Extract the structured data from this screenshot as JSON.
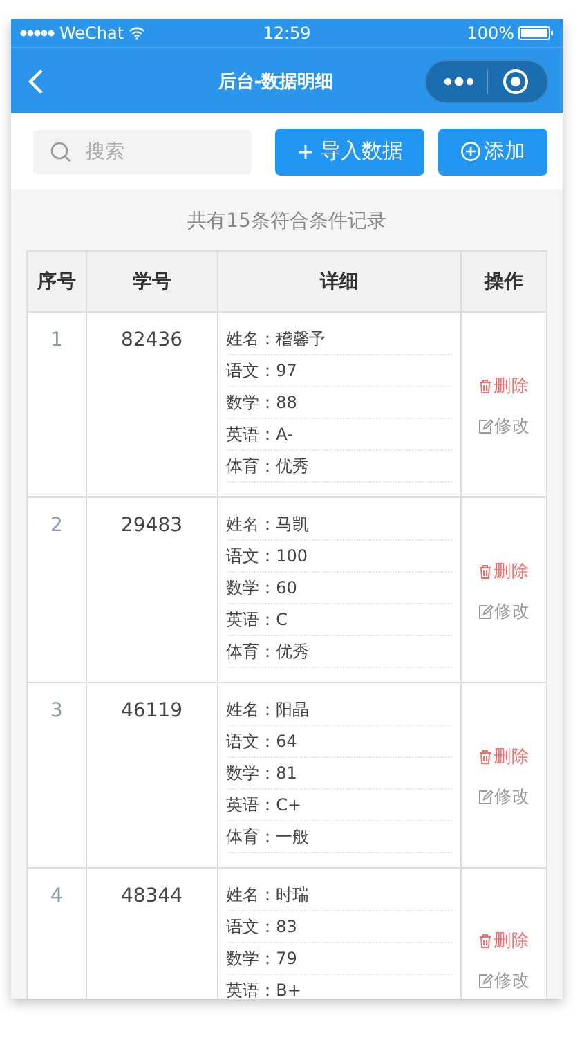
{
  "status_bar": {
    "carrier": "WeChat",
    "time": "12:59",
    "battery": "100%"
  },
  "nav": {
    "title": "后台-数据明细"
  },
  "toolbar": {
    "search": {
      "placeholder": "搜索"
    },
    "import_button": "导入数据",
    "add_button": "添加"
  },
  "summary": "共有15条符合条件记录",
  "table": {
    "columns": [
      "序号",
      "学号",
      "详细",
      "操作"
    ],
    "rows": [
      {
        "index": "1",
        "student_id": "82436",
        "details": [
          "姓名：稽馨予",
          "语文：97",
          "数学：88",
          "英语：A-",
          "体育：优秀"
        ],
        "delete": "删除",
        "edit": "修改"
      },
      {
        "index": "2",
        "student_id": "29483",
        "details": [
          "姓名：马凯",
          "语文：100",
          "数学：60",
          "英语：C",
          "体育：优秀"
        ],
        "delete": "删除",
        "edit": "修改"
      },
      {
        "index": "3",
        "student_id": "46119",
        "details": [
          "姓名：阳晶",
          "语文：64",
          "数学：81",
          "英语：C+",
          "体育：一般"
        ],
        "delete": "删除",
        "edit": "修改"
      },
      {
        "index": "4",
        "student_id": "48344",
        "details": [
          "姓名：时瑞",
          "语文：83",
          "数学：79",
          "英语：B+"
        ],
        "delete": "删除",
        "edit": "修改"
      }
    ]
  }
}
